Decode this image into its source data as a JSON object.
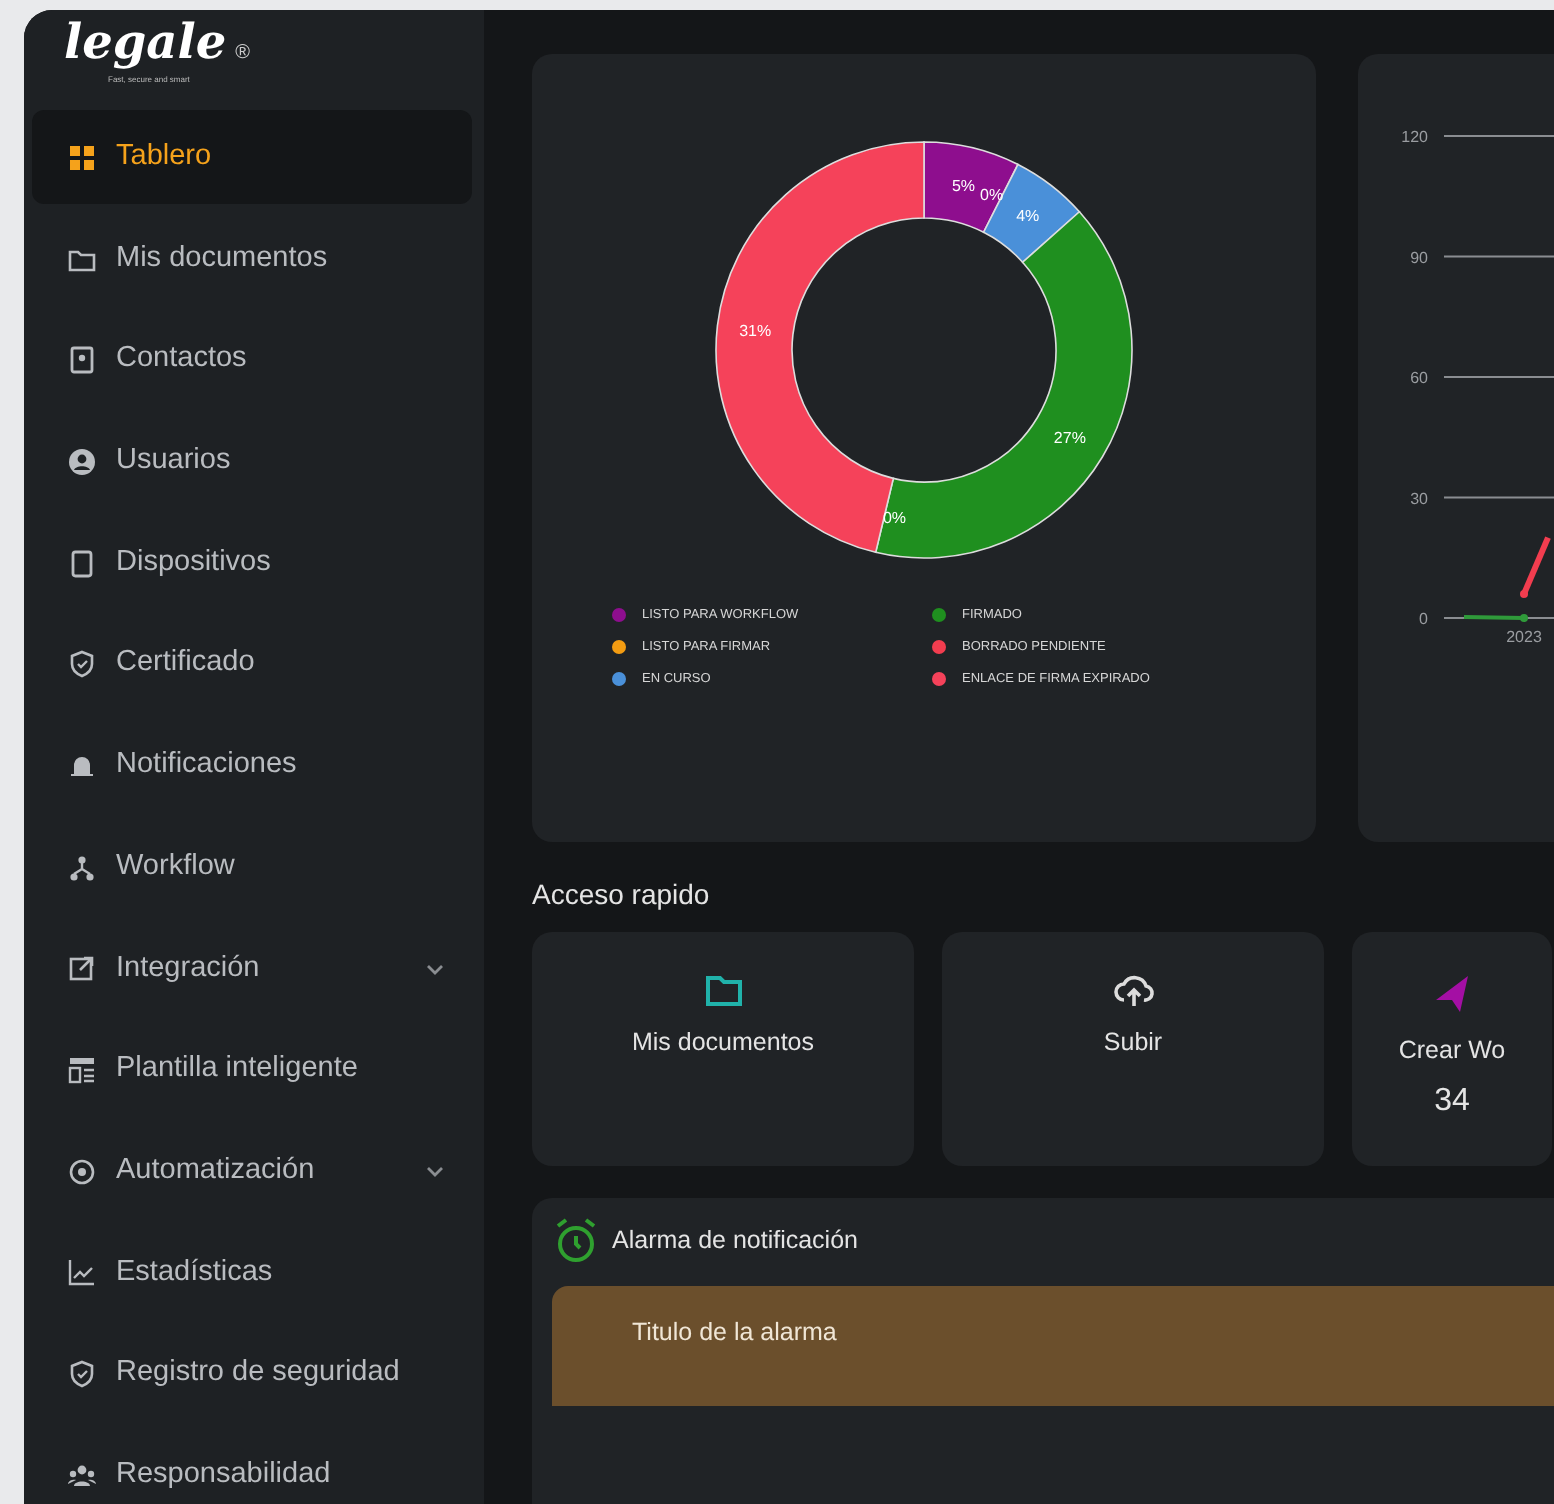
{
  "brand": {
    "logo": "legale",
    "mark": "®",
    "tagline": "Fast, secure and smart"
  },
  "sidebar": {
    "items": [
      {
        "label": "Tablero",
        "kind": "link",
        "selected": true
      },
      {
        "label": "Mis documentos",
        "kind": "link",
        "selected": false
      },
      {
        "label": "Contactos",
        "kind": "link",
        "selected": false
      },
      {
        "label": "Usuarios",
        "kind": "link",
        "selected": false
      },
      {
        "label": "Dispositivos",
        "kind": "link",
        "selected": false
      },
      {
        "label": "Certificado",
        "kind": "link",
        "selected": false
      },
      {
        "label": "Notificaciones",
        "kind": "link",
        "selected": false
      },
      {
        "label": "Workflow",
        "kind": "link",
        "selected": false
      },
      {
        "label": "Integración",
        "kind": "group",
        "expanded": false,
        "selected": false
      },
      {
        "label": "Plantilla inteligente",
        "kind": "link",
        "selected": false
      },
      {
        "label": "Automatización",
        "kind": "group",
        "expanded": false,
        "selected": false
      },
      {
        "label": "Estadísticas",
        "kind": "link",
        "selected": false
      },
      {
        "label": "Registro de seguridad",
        "kind": "link",
        "selected": false
      },
      {
        "label": "Responsabilidad",
        "kind": "link",
        "selected": false
      }
    ]
  },
  "status_chart": {
    "chart_data": {
      "type": "donut",
      "categories": [
        "LISTO PARA WORKFLOW",
        "LISTO PARA FIRMAR",
        "EN CURSO",
        "FIRMADO",
        "BORRADO PENDIENTE",
        "ENLACE DE FIRMA EXPIRADO"
      ],
      "series": [
        {
          "colors": [
            "#8e0e8e",
            "#f39c12",
            "#4a90d9",
            "#1f8f1f",
            "#f23d4f",
            "#f5425a"
          ],
          "values": [
            7.46,
            0,
            5.97,
            40.3,
            0,
            46.27
          ]
        }
      ],
      "value_labels": [
        "5%",
        "0%",
        "4%",
        "27%",
        "0%",
        "31%"
      ]
    }
  },
  "activity_chart": {
    "chart_data": {
      "type": "line",
      "categories": [
        "2023"
      ],
      "ylim": [
        0,
        120
      ],
      "yticks": [
        0,
        30,
        60,
        90,
        120
      ],
      "grid": true,
      "series": [
        {
          "color": "#2f9a3a",
          "marker": true,
          "values": [
            0
          ]
        },
        {
          "color": "#f23d4f",
          "marker": true,
          "values": [
            6
          ]
        }
      ]
    }
  },
  "quick_access": {
    "title": "Acceso rapido",
    "items": [
      {
        "label": "Mis documentos"
      },
      {
        "label": "Subir"
      },
      {
        "label": "Crear Wo",
        "count": "34"
      }
    ]
  },
  "alarms": {
    "title": "Alarma de notificación",
    "columns": [
      "Titulo de la alarma"
    ]
  }
}
